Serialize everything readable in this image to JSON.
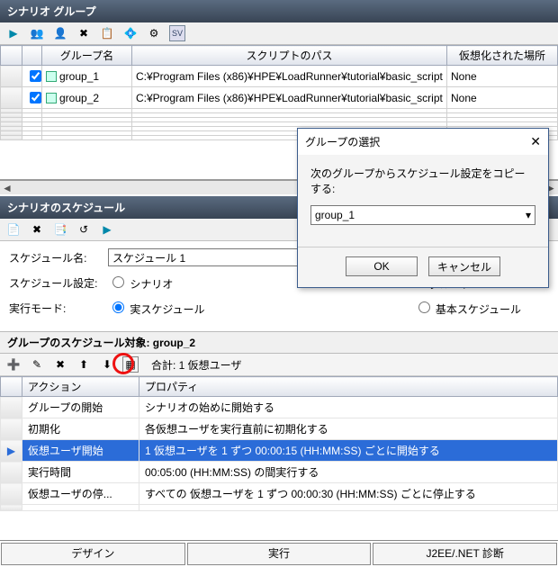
{
  "panel1": {
    "title": "シナリオ グループ"
  },
  "toolbar1": {
    "play": "▶",
    "users": "👥",
    "edituser": "👤",
    "del": "✖",
    "paste": "📋",
    "badge": "💠",
    "cfg": "⚙",
    "sv": "SV"
  },
  "grid1": {
    "headers": {
      "handle": "",
      "chk": "",
      "group": "グループ名",
      "path": "スクリプトのパス",
      "virt": "仮想化された場所"
    },
    "rows": [
      {
        "chk": true,
        "group": "group_1",
        "path": "C:¥Program Files (x86)¥HPE¥LoadRunner¥tutorial¥basic_script",
        "virt": "None"
      },
      {
        "chk": true,
        "group": "group_2",
        "path": "C:¥Program Files (x86)¥HPE¥LoadRunner¥tutorial¥basic_script",
        "virt": "None"
      }
    ]
  },
  "panel2": {
    "title": "シナリオのスケジュール"
  },
  "toolbar2": {
    "new": "📄",
    "del": "✖",
    "copy": "📑",
    "reset": "↺",
    "run": "▶"
  },
  "form": {
    "name_label": "スケジュール名:",
    "name_value": "スケジュール 1",
    "setting_label": "スケジュール設定:",
    "opt_scenario": "シナリオ",
    "opt_group": "グループ",
    "mode_label": "実行モード:",
    "opt_real": "実スケジュール",
    "opt_basic": "基本スケジュール"
  },
  "section": {
    "title": "グループのスケジュール対象: group_2",
    "total": "合計: 1 仮想ユーザ"
  },
  "minitb": {
    "add": "➕",
    "edit": "✎",
    "del": "✖",
    "up": "⬆",
    "down": "⬇",
    "grid": "▦"
  },
  "sched": {
    "headers": {
      "action": "アクション",
      "prop": "プロパティ"
    },
    "rows": [
      {
        "action": "グループの開始",
        "prop": "シナリオの始めに開始する"
      },
      {
        "action": "初期化",
        "prop": "各仮想ユーザを実行直前に初期化する"
      },
      {
        "action": "仮想ユーザ開始",
        "prop": "1 仮想ユーザを 1 ずつ 00:00:15 (HH:MM:SS) ごとに開始する",
        "sel": true
      },
      {
        "action": "実行時間",
        "prop": "00:05:00 (HH:MM:SS) の間実行する"
      },
      {
        "action": "仮想ユーザの停...",
        "prop": "すべての 仮想ユーザを 1 ずつ 00:00:30 (HH:MM:SS) ごとに停止する"
      }
    ]
  },
  "dialog": {
    "title": "グループの選択",
    "msg": "次のグループからスケジュール設定をコピーする:",
    "value": "group_1",
    "ok": "OK",
    "cancel": "キャンセル",
    "close": "✕"
  },
  "footer": {
    "design": "デザイン",
    "exec": "実行",
    "diag": "J2EE/.NET 診断"
  }
}
